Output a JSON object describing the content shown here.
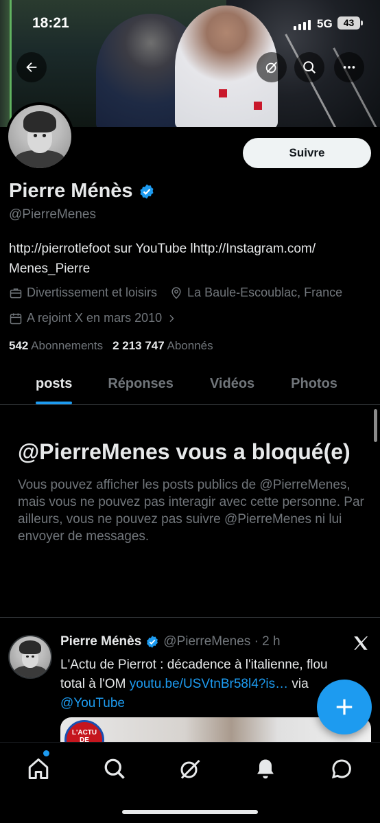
{
  "status_bar": {
    "time": "18:21",
    "network": "5G",
    "battery": "43"
  },
  "profile": {
    "name": "Pierre Ménès",
    "handle": "@PierreMenes",
    "bio": "http://pierrotlefoot sur YouTube lhttp://Instagram.com/ Menes_Pierre",
    "category": "Divertissement et loisirs",
    "location": "La Baule-Escoublac, France",
    "joined": "A rejoint X en mars 2010",
    "following_count": "542",
    "following_label": "Abonnements",
    "followers_count": "2 213 747",
    "followers_label": "Abonnés",
    "follow_button": "Suivre"
  },
  "tabs": [
    {
      "label": "posts",
      "active": true
    },
    {
      "label": "Réponses",
      "active": false
    },
    {
      "label": "Vidéos",
      "active": false
    },
    {
      "label": "Photos",
      "active": false
    }
  ],
  "blocked_notice": {
    "title": "@PierreMenes vous a bloqué(e)",
    "body": "Vous pouvez afficher les posts publics de @PierreMenes, mais vous ne pouvez pas interagir avec cette personne. Par ailleurs, vous ne pouvez pas suivre @PierreMenes ni lui envoyer de messages."
  },
  "post": {
    "author_name": "Pierre Ménès",
    "author_handle_time": "@PierreMenes · 2 h",
    "text_start": "L'Actu de Pierrot : décadence à l'italienne, flou total à l'OM ",
    "link": "youtu.be/USVtnBr58l4?is…",
    "text_via": " via ",
    "mention": "@YouTube",
    "media_badge": "L'ACTU DE"
  },
  "icons": {
    "back": "back-arrow-icon",
    "grok": "grok-icon",
    "search": "search-icon",
    "more": "more-icon",
    "category": "briefcase-icon",
    "location": "location-pin-icon",
    "calendar": "calendar-icon",
    "compose": "plus-icon",
    "nav": [
      "home-icon",
      "search-icon",
      "grok-icon",
      "bell-icon",
      "chat-icon"
    ]
  },
  "colors": {
    "accent": "#1d9bf0",
    "background": "#000000",
    "muted": "#71767b"
  }
}
